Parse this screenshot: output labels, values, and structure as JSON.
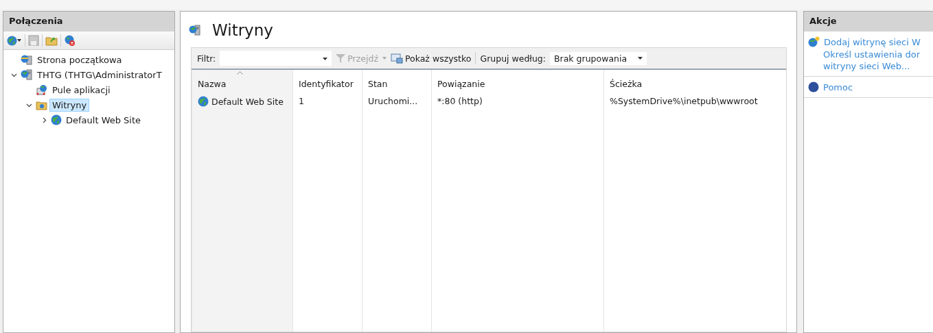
{
  "connections": {
    "title": "Połączenia",
    "tree": [
      {
        "label": "Strona początkowa",
        "kind": "start",
        "selected": false
      },
      {
        "label": "THTG (THTG\\AdministratorT",
        "kind": "server",
        "selected": false,
        "expanded": true,
        "children": [
          {
            "label": "Pule aplikacji",
            "kind": "pool",
            "selected": false
          },
          {
            "label": "Witryny",
            "kind": "sites",
            "selected": true,
            "expanded": true,
            "children": [
              {
                "label": "Default Web Site",
                "kind": "site",
                "selected": false,
                "expanded": false
              }
            ]
          }
        ]
      }
    ]
  },
  "content": {
    "title": "Witryny",
    "filter_bar": {
      "filter_label": "Filtr:",
      "go": {
        "label": "Przejdź",
        "disabled": true
      },
      "show_all": "Pokaż wszystko",
      "group_label": "Grupuj według:",
      "group_value": "Brak grupowania"
    },
    "table": {
      "columns": [
        {
          "label": "Nazwa",
          "sorted": true
        },
        {
          "label": "Identyfikator",
          "sorted": false
        },
        {
          "label": "Stan",
          "sorted": false
        },
        {
          "label": "Powiązanie",
          "sorted": false
        },
        {
          "label": "Ścieżka",
          "sorted": false
        }
      ],
      "rows": [
        {
          "selected": false,
          "cells": [
            "Default Web Site",
            "1",
            "Uruchomi...",
            "*:80 (http)",
            "%SystemDrive%\\inetpub\\wwwroot"
          ]
        }
      ]
    }
  },
  "actions": {
    "title": "Akcje",
    "groups": [
      [
        {
          "kind": "add",
          "label": "Dodaj witrynę sieci W"
        },
        {
          "kind": "text",
          "label": "Określ ustawienia dor"
        },
        {
          "kind": "text",
          "label": "witryny sieci Web..."
        }
      ],
      [
        {
          "kind": "help",
          "label": "Pomoc"
        }
      ]
    ]
  }
}
